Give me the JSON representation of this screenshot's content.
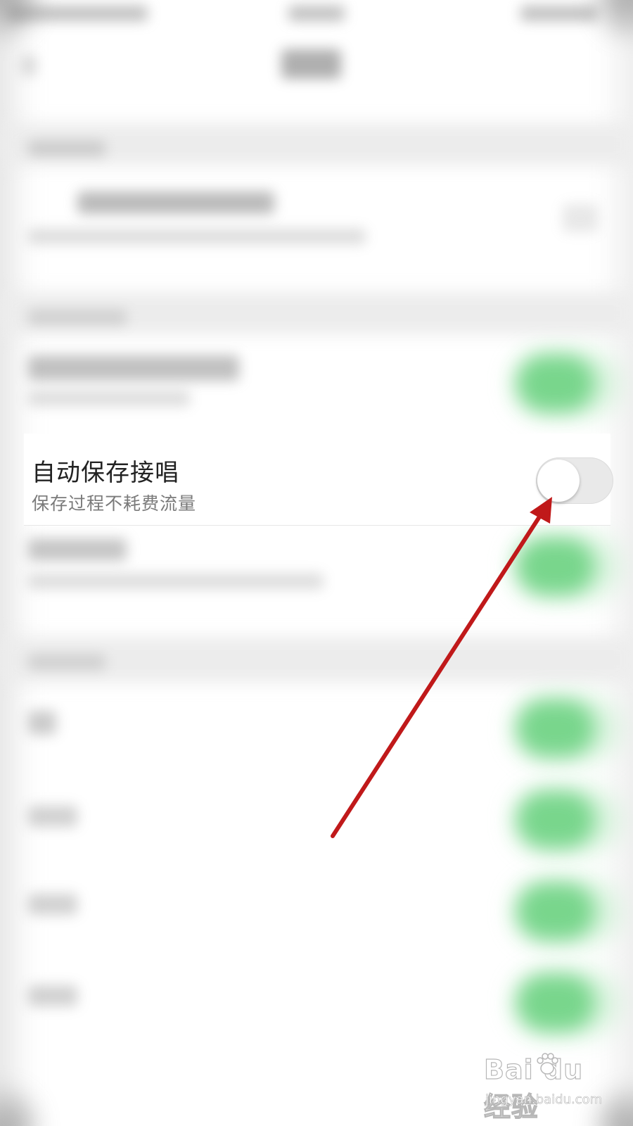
{
  "setting_row": {
    "title": "自动保存接唱",
    "subtitle": "保存过程不耗费流量",
    "toggle_state": "off"
  },
  "colors": {
    "toggle_off_track": "#e9e9e9",
    "toggle_on_green": "#69d17f",
    "annotation_arrow": "#c0191a"
  },
  "watermark": {
    "logo": "Bai du 经验",
    "url": "jingyan.baidu.com"
  }
}
